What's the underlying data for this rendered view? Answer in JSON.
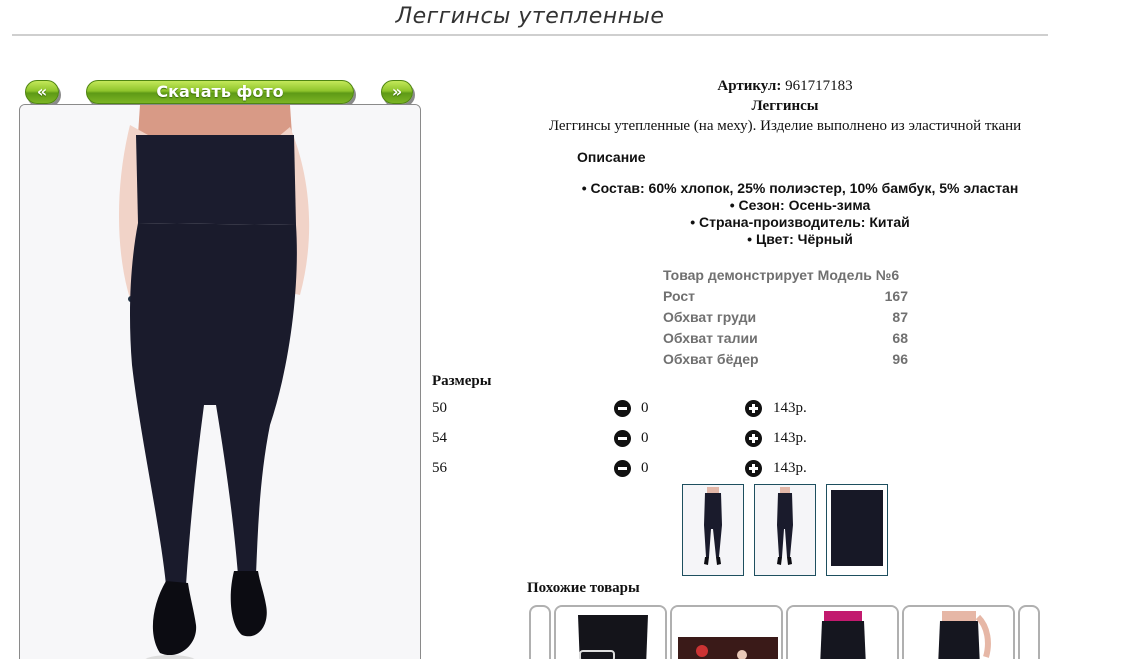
{
  "page": {
    "title": "Леггинсы утепленные"
  },
  "gallery": {
    "prev_label": "«",
    "download_label": "Скачать фото",
    "next_label": "»"
  },
  "product": {
    "article_label": "Артикул:",
    "article_value": "961717183",
    "category": "Леггинсы",
    "summary": "Леггинсы утепленные (на меху). Изделие выполнено из эластичной ткани"
  },
  "description": {
    "heading": "Описание",
    "bullets": [
      "Состав: 60% хлопок, 25% полиэстер, 10% бамбук, 5% эластан",
      "Сезон: Осень-зима",
      "Страна-производитель: Китай",
      "Цвет: Чёрный"
    ]
  },
  "model": {
    "heading": "Товар демонстрирует Модель №6",
    "rows": [
      {
        "label": "Рост",
        "value": "167"
      },
      {
        "label": "Обхват груди",
        "value": "87"
      },
      {
        "label": "Обхват талии",
        "value": "68"
      },
      {
        "label": "Обхват бёдер",
        "value": "96"
      }
    ]
  },
  "sizes": {
    "heading": "Размеры",
    "rows": [
      {
        "size": "50",
        "qty": "0",
        "price": "143р."
      },
      {
        "size": "54",
        "qty": "0",
        "price": "143р."
      },
      {
        "size": "56",
        "qty": "0",
        "price": "143р."
      }
    ]
  },
  "similar": {
    "heading": "Похожие товары"
  },
  "colors": {
    "accent_green": "#7cb524",
    "thumb_border": "#1e4f5f",
    "text_gray": "#707070"
  }
}
